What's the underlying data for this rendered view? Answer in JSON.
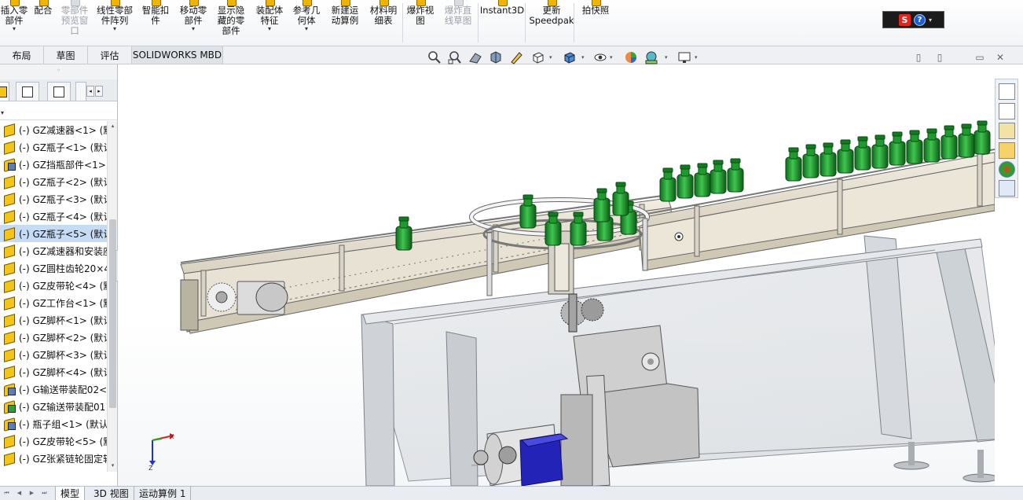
{
  "ribbon": {
    "buttons": [
      {
        "id": "insert-component",
        "label": "插入零\n部件",
        "drop": "▾",
        "grey": false
      },
      {
        "id": "mate",
        "label": "配合",
        "drop": "",
        "grey": false
      },
      {
        "id": "component-preview",
        "label": "零部件\n预览窗\n口",
        "drop": "",
        "grey": true
      },
      {
        "id": "linear-pattern",
        "label": "线性零部\n件阵列",
        "drop": "▾",
        "grey": false
      },
      {
        "id": "smart-fasteners",
        "label": "智能扣\n件",
        "drop": "",
        "grey": false
      },
      {
        "id": "move-component",
        "label": "移动零\n部件",
        "drop": "▾",
        "grey": false
      },
      {
        "id": "show-hidden",
        "label": "显示隐\n藏的零\n部件",
        "drop": "",
        "grey": false
      },
      {
        "id": "assembly-features",
        "label": "装配体\n特征",
        "drop": "▾",
        "grey": false
      },
      {
        "id": "reference-geometry",
        "label": "参考几\n何体",
        "drop": "▾",
        "grey": false
      },
      {
        "id": "new-motion-study",
        "label": "新建运\n动算例",
        "drop": "",
        "grey": false
      },
      {
        "id": "bill-of-materials",
        "label": "材料明\n细表",
        "drop": "",
        "grey": false
      },
      {
        "id": "exploded-view",
        "label": "爆炸视\n图",
        "drop": "",
        "grey": false
      },
      {
        "id": "explode-line-sketch",
        "label": "爆炸直\n线草图",
        "drop": "",
        "grey": true
      },
      {
        "id": "instant3d",
        "label": "Instant3D",
        "drop": "",
        "grey": false
      },
      {
        "id": "update-speedpak",
        "label": "更新\nSpeedpak",
        "drop": "",
        "grey": false
      },
      {
        "id": "take-snapshot",
        "label": "拍快照",
        "drop": "",
        "grey": false
      }
    ],
    "search_logo": "S",
    "help_glyph": "?",
    "search_arrow": "▾"
  },
  "command_tabs": [
    "布局",
    "草图",
    "评估",
    "SOLIDWORKS MBD"
  ],
  "panel": {
    "grip": "◦",
    "filter_arrow": "▾",
    "scroll_left": "◂",
    "scroll_right": "▸",
    "collapse_arrow": "‹",
    "tree_scroll_up": "▴",
    "tree_scroll_down": "▾"
  },
  "tree": {
    "items": [
      {
        "label": "(-) GZ减速器<1> (默认",
        "type": "part",
        "selected": false
      },
      {
        "label": "(-) GZ瓶子<1> (默认",
        "type": "part",
        "selected": false
      },
      {
        "label": "(-) GZ挡瓶部件<1>",
        "type": "asm",
        "selected": false
      },
      {
        "label": "(-) GZ瓶子<2> (默认",
        "type": "part",
        "selected": false
      },
      {
        "label": "(-) GZ瓶子<3> (默认",
        "type": "part",
        "selected": false
      },
      {
        "label": "(-) GZ瓶子<4> (默认",
        "type": "part",
        "selected": false
      },
      {
        "label": "(-) GZ瓶子<5> (默认",
        "type": "part",
        "selected": true
      },
      {
        "label": "(-) GZ减速器和安装座",
        "type": "part",
        "selected": false
      },
      {
        "label": "(-) GZ圆柱齿轮20×4",
        "type": "part",
        "selected": false
      },
      {
        "label": "(-) GZ皮带轮<4> (默",
        "type": "part",
        "selected": false
      },
      {
        "label": "(-) GZ工作台<1> (默",
        "type": "part",
        "selected": false
      },
      {
        "label": "(-) GZ脚杯<1> (默认",
        "type": "part",
        "selected": false
      },
      {
        "label": "(-) GZ脚杯<2> (默认",
        "type": "part",
        "selected": false
      },
      {
        "label": "(-) GZ脚杯<3> (默认",
        "type": "part",
        "selected": false
      },
      {
        "label": "(-) GZ脚杯<4> (默认",
        "type": "part",
        "selected": false
      },
      {
        "label": "(-) G输送带装配02<",
        "type": "asm",
        "selected": false
      },
      {
        "label": "(-) GZ输送带装配01",
        "type": "asm2",
        "selected": false
      },
      {
        "label": "(-) 瓶子组<1> (默认",
        "type": "asm",
        "selected": false
      },
      {
        "label": "(-) GZ皮带轮<5> (默",
        "type": "part",
        "selected": false
      },
      {
        "label": "(-) GZ张紧链轮固定轴",
        "type": "part",
        "selected": false
      }
    ]
  },
  "viewport": {
    "triad_x": "X",
    "triad_z": "Z",
    "window_buttons": [
      "▯",
      "▯",
      "▭",
      "✕"
    ]
  },
  "bottom_tabs": [
    "模型",
    "3D 视图",
    "运动算例 1"
  ],
  "bottom_nav": [
    "⏮",
    "◀",
    "▶",
    "⏭"
  ],
  "colors": {
    "bottle": "#1f9a2e",
    "frame": "#c7c7c7",
    "conveyor": "#e8e3d6",
    "motor": "#2323b8"
  }
}
